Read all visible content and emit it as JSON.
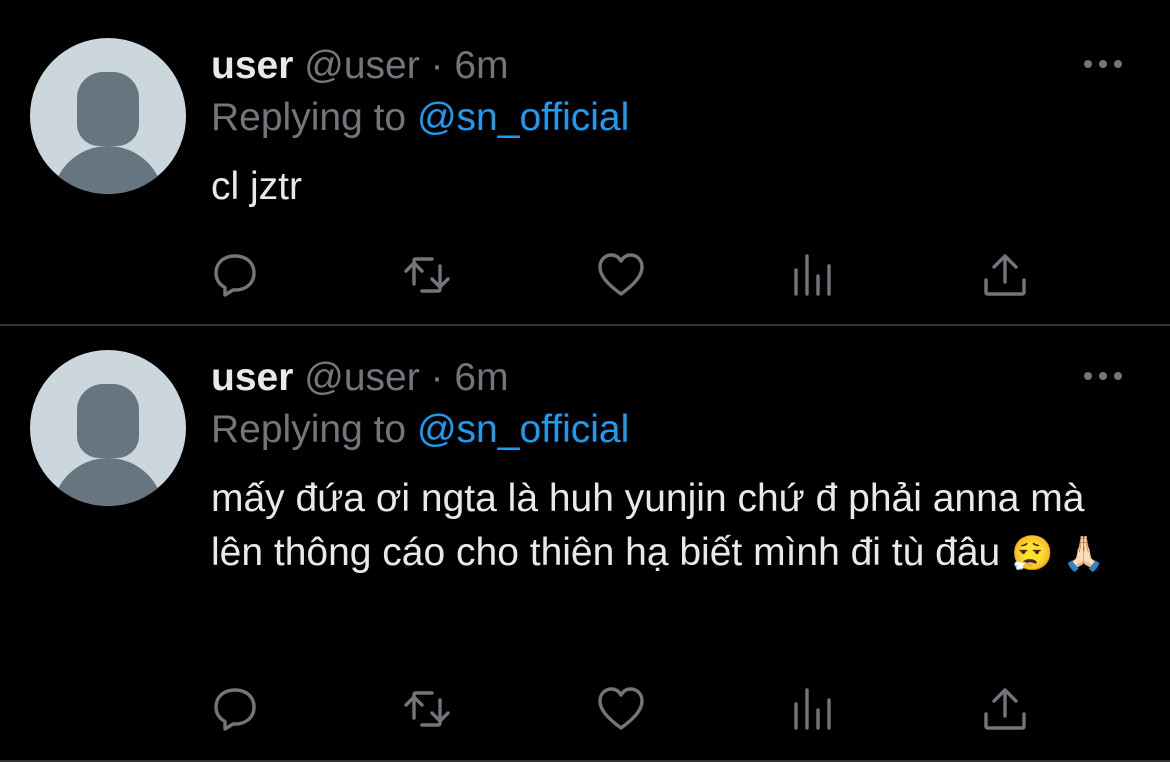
{
  "colors": {
    "background": "#000000",
    "primary_text": "#e7e9ea",
    "secondary_text": "#71767b",
    "link": "#1d9bf0",
    "divider": "#2f3336"
  },
  "tweets": [
    {
      "display_name": "user",
      "handle": "@user",
      "separator": "·",
      "time": "6m",
      "replying_prefix": "Replying to",
      "replying_to": "@sn_official",
      "text": "cl jztr",
      "emojis": ""
    },
    {
      "display_name": "user",
      "handle": "@user",
      "separator": "·",
      "time": "6m",
      "replying_prefix": "Replying to",
      "replying_to": "@sn_official",
      "text": "mấy đứa ơi ngta là huh yunjin chứ đ phải anna mà lên thông cáo cho thiên hạ biết mình đi tù đâu",
      "emojis": "😮‍💨 🙏🏻"
    }
  ],
  "icons": {
    "more": "more-horizontal-icon",
    "reply": "reply-bubble-icon",
    "retweet": "retweet-icon",
    "like": "heart-icon",
    "views": "bar-chart-icon",
    "share": "share-upload-icon"
  }
}
